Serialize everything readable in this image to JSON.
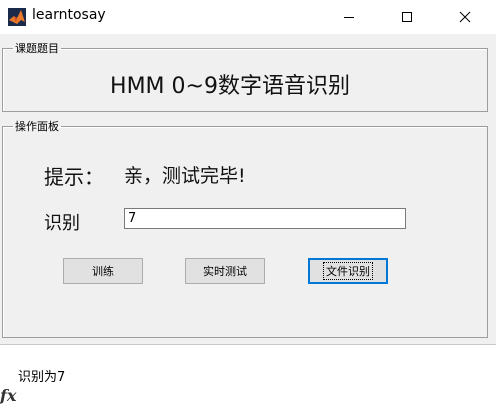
{
  "window": {
    "title": "learntosay"
  },
  "topic_group": {
    "legend": "课题题目",
    "title": "HMM 0~9数字语音识别"
  },
  "panel_group": {
    "legend": "操作面板",
    "hint_label": "提示：",
    "hint_value": "亲，测试完毕!",
    "result_label": "识别",
    "result_value": "7",
    "buttons": {
      "train": "训练",
      "realtime": "实时测试",
      "file": "文件识别"
    }
  },
  "command_window": {
    "output": "识别为7"
  },
  "colors": {
    "window_bg": "#f0f0f0",
    "focus_border": "#0078d7"
  }
}
